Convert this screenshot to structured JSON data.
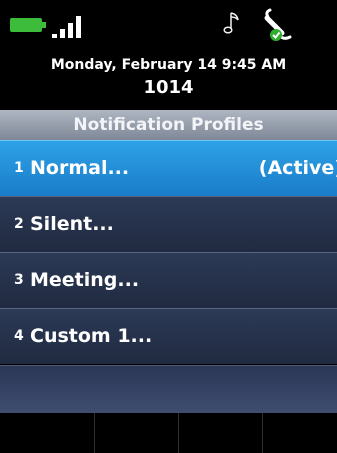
{
  "status_bar": {
    "battery_color": "#3dbb3a",
    "icons": [
      "battery-icon",
      "signal-icon",
      "music-note-icon",
      "headset-icon"
    ]
  },
  "header": {
    "datetime": "Monday, February 14 9:45 AM",
    "extension": "1014"
  },
  "screen_title": "Notification Profiles",
  "profiles": [
    {
      "number": "1",
      "label": "Normal...",
      "status": "(Active)"
    },
    {
      "number": "2",
      "label": "Silent..."
    },
    {
      "number": "3",
      "label": "Meeting..."
    },
    {
      "number": "4",
      "label": "Custom 1..."
    }
  ],
  "colors": {
    "active_item": "#1f8bd7",
    "item_background": "#26324b",
    "title_bar": "#959daa"
  }
}
